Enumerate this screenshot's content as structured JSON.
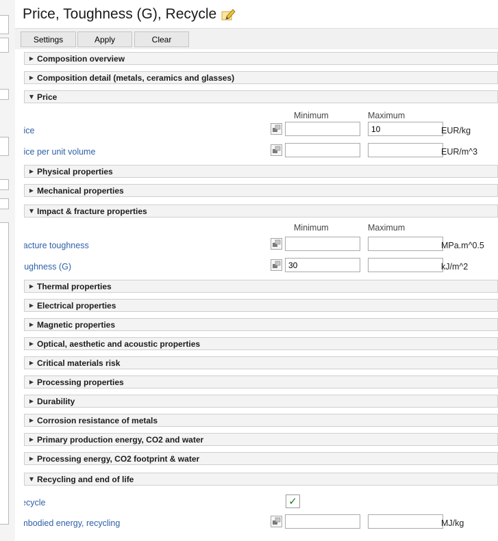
{
  "header": {
    "title": "Price, Toughness (G), Recycle",
    "edit_icon": "pencil-edit-icon"
  },
  "toolbar": {
    "settings_label": "Settings",
    "apply_label": "Apply",
    "clear_label": "Clear"
  },
  "columns": {
    "minimum": "Minimum",
    "maximum": "Maximum"
  },
  "sections": [
    {
      "label": "Composition overview",
      "expanded": false
    },
    {
      "label": "Composition detail (metals, ceramics and glasses)",
      "expanded": false
    },
    {
      "label": "Price",
      "expanded": true,
      "properties": [
        {
          "label": "Price",
          "min": "",
          "max": "10",
          "unit": "EUR/kg"
        },
        {
          "label": "Price per unit volume",
          "min": "",
          "max": "",
          "unit": "EUR/m^3"
        }
      ]
    },
    {
      "label": "Physical properties",
      "expanded": false
    },
    {
      "label": "Mechanical properties",
      "expanded": false
    },
    {
      "label": "Impact & fracture properties",
      "expanded": true,
      "properties": [
        {
          "label": "Fracture toughness",
          "min": "",
          "max": "",
          "unit": "MPa.m^0.5"
        },
        {
          "label": "Toughness (G)",
          "min": "30",
          "max": "",
          "unit": "kJ/m^2"
        }
      ]
    },
    {
      "label": "Thermal properties",
      "expanded": false
    },
    {
      "label": "Electrical properties",
      "expanded": false
    },
    {
      "label": "Magnetic properties",
      "expanded": false
    },
    {
      "label": "Optical, aesthetic and acoustic properties",
      "expanded": false
    },
    {
      "label": "Critical materials risk",
      "expanded": false
    },
    {
      "label": "Processing properties",
      "expanded": false
    },
    {
      "label": "Durability",
      "expanded": false
    },
    {
      "label": "Corrosion resistance of metals",
      "expanded": false
    },
    {
      "label": "Primary production energy, CO2 and water",
      "expanded": false
    },
    {
      "label": "Processing energy, CO2 footprint & water",
      "expanded": false
    },
    {
      "label": "Recycling and end of life",
      "expanded": true,
      "properties": [
        {
          "label": "Recycle",
          "checked": true,
          "check_mark": "✓"
        },
        {
          "label": "Embodied energy, recycling",
          "min": "",
          "max": "",
          "unit": "MJ/kg"
        }
      ]
    }
  ],
  "colors": {
    "link_blue": "#2e5fa8",
    "check_green": "#137a1e",
    "section_bg": "#f3f3f3"
  }
}
